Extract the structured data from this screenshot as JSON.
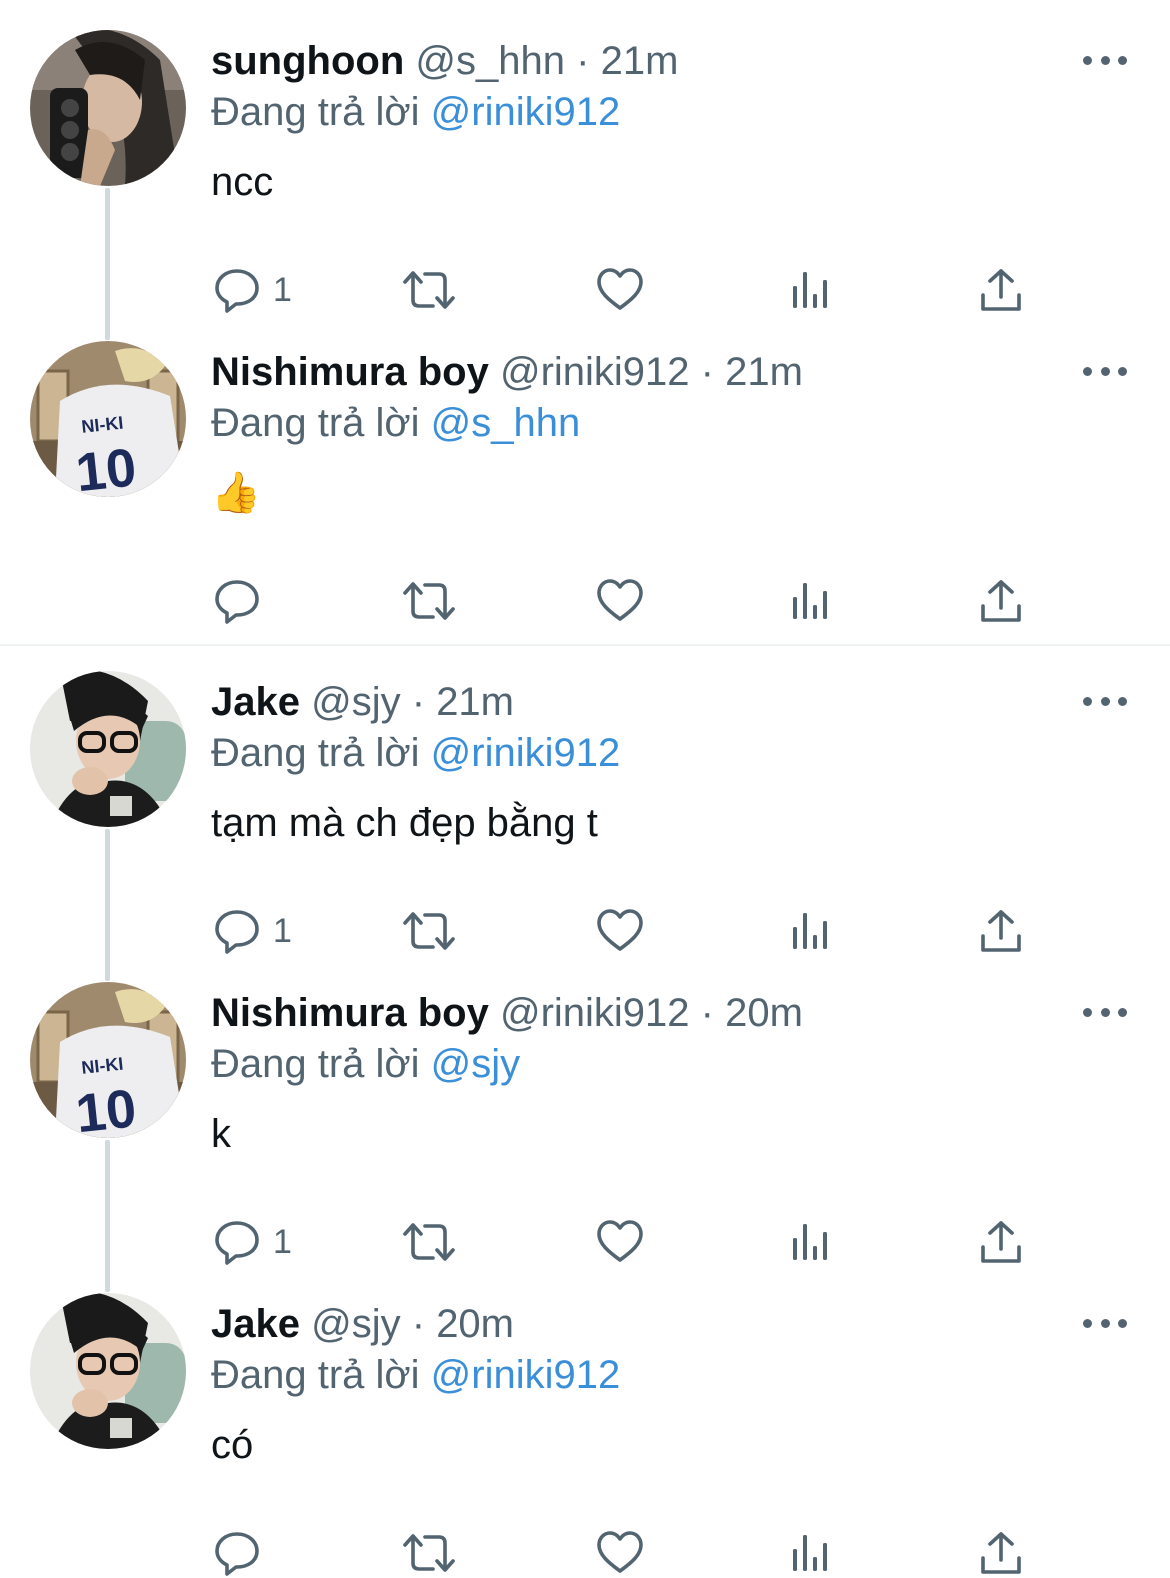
{
  "tweets": [
    {
      "name": "sunghoon",
      "handle": "@s_hhn",
      "time": "21m",
      "reply_prefix": "Đang trả lời",
      "reply_to": "@riniki912",
      "text": "ncc",
      "reply_count": "1",
      "avatar": "avatar-sunghoon"
    },
    {
      "name": "Nishimura boy",
      "handle": "@riniki912",
      "time": "21m",
      "reply_prefix": "Đang trả lời",
      "reply_to": "@s_hhn",
      "text": "👍",
      "reply_count": "",
      "avatar": "avatar-niki"
    },
    {
      "name": "Jake",
      "handle": "@sjy",
      "time": "21m",
      "reply_prefix": "Đang trả lời",
      "reply_to": "@riniki912",
      "text": "tạm mà ch đẹp bằng t",
      "reply_count": "1",
      "avatar": "avatar-jake"
    },
    {
      "name": "Nishimura boy",
      "handle": "@riniki912",
      "time": "20m",
      "reply_prefix": "Đang trả lời",
      "reply_to": "@sjy",
      "text": "k",
      "reply_count": "1",
      "avatar": "avatar-niki"
    },
    {
      "name": "Jake",
      "handle": "@sjy",
      "time": "20m",
      "reply_prefix": "Đang trả lời",
      "reply_to": "@riniki912",
      "text": "có",
      "reply_count": "",
      "avatar": "avatar-jake"
    }
  ],
  "separator": "·",
  "avatar_jersey": {
    "name": "NI-KI",
    "number": "10"
  },
  "icons": [
    "reply-icon",
    "retweet-icon",
    "like-icon",
    "views-icon",
    "share-icon",
    "more-icon"
  ],
  "colors": {
    "mention": "#3b8fd9",
    "secondary": "#536471",
    "thread_line": "#cfd9de"
  }
}
